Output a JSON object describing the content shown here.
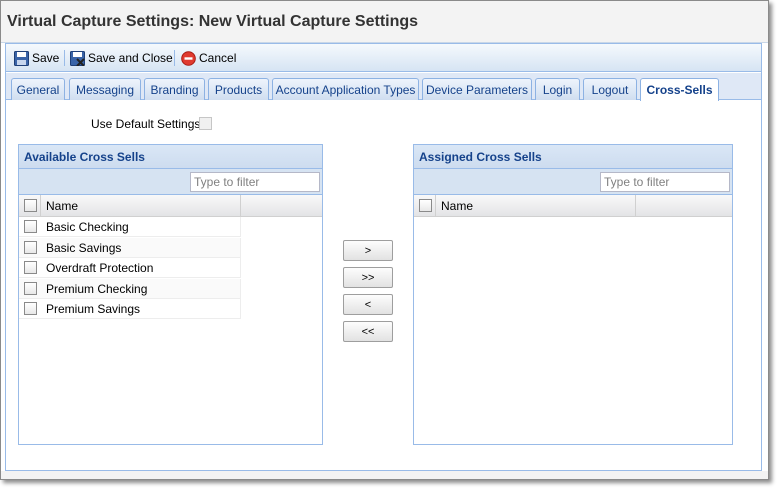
{
  "window": {
    "title": "Virtual Capture Settings: New Virtual Capture Settings"
  },
  "toolbar": {
    "save_label": "Save",
    "save_close_label": "Save and Close",
    "cancel_label": "Cancel"
  },
  "tabs": [
    {
      "label": "General"
    },
    {
      "label": "Messaging"
    },
    {
      "label": "Branding"
    },
    {
      "label": "Products"
    },
    {
      "label": "Account Application Types"
    },
    {
      "label": "Device Parameters"
    },
    {
      "label": "Login"
    },
    {
      "label": "Logout"
    },
    {
      "label": "Cross-Sells",
      "active": true
    }
  ],
  "settings": {
    "use_default_label": "Use Default Settings:"
  },
  "available": {
    "title": "Available Cross Sells",
    "filter_placeholder": "Type to filter",
    "column_name": "Name",
    "rows": [
      "Basic Checking",
      "Basic Savings",
      "Overdraft Protection",
      "Premium Checking",
      "Premium Savings"
    ]
  },
  "assigned": {
    "title": "Assigned Cross Sells",
    "filter_placeholder": "Type to filter",
    "column_name": "Name",
    "rows": []
  },
  "move_buttons": {
    "add": ">",
    "add_all": ">>",
    "remove": "<",
    "remove_all": "<<"
  }
}
